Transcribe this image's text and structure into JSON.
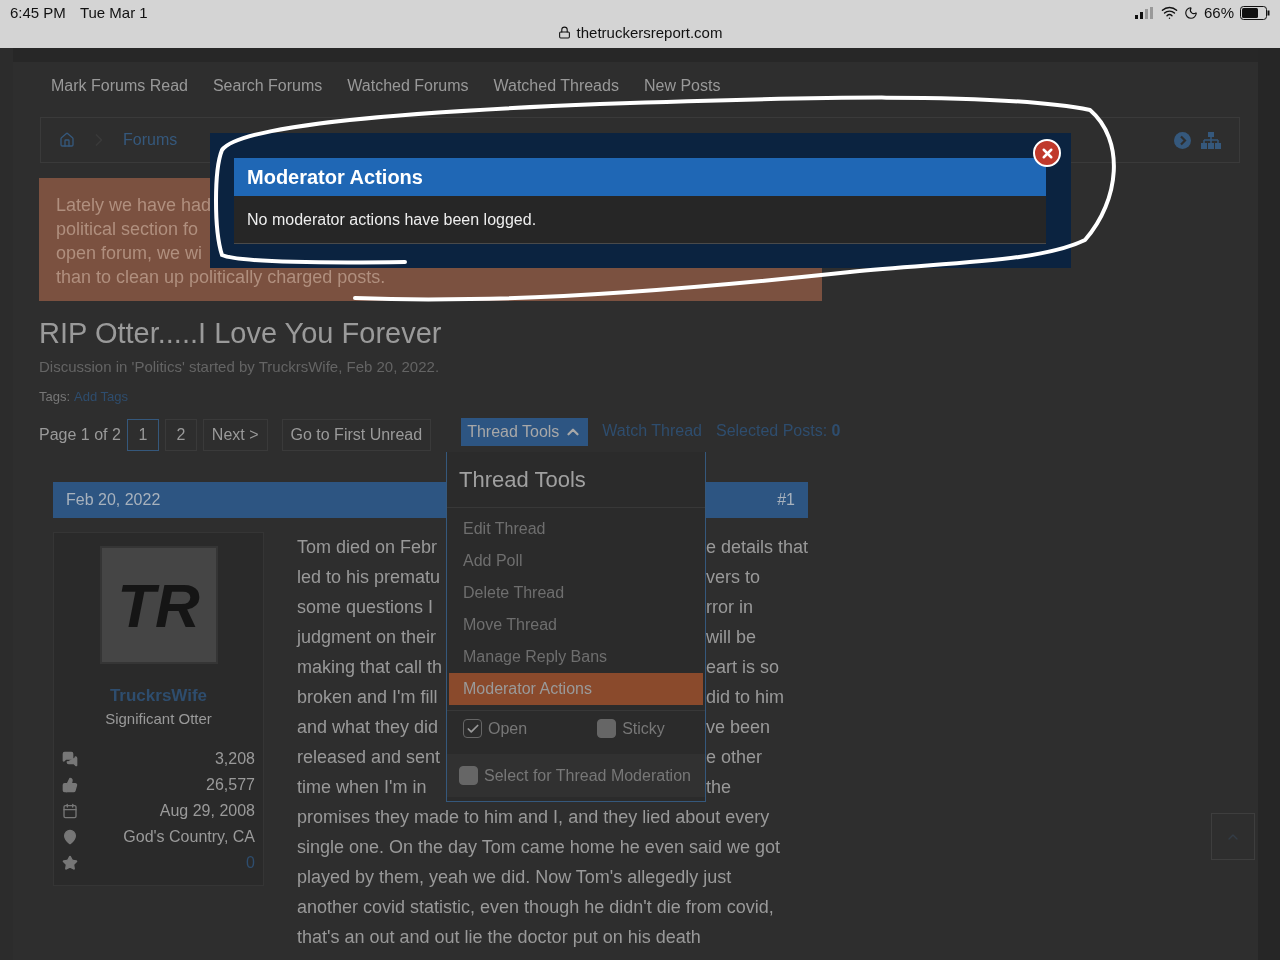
{
  "status_bar": {
    "time": "6:45 PM",
    "date": "Tue Mar 1",
    "url": "thetruckersreport.com",
    "battery": "66%"
  },
  "nav_tabs": [
    "Mark Forums Read",
    "Search Forums",
    "Watched Forums",
    "Watched Threads",
    "New Posts"
  ],
  "breadcrumb": {
    "items": [
      "Forums"
    ]
  },
  "notice": {
    "lines": [
      "Lately we have had",
      "political section fo",
      "open forum, we wi",
      "than to clean up politically charged posts."
    ]
  },
  "thread": {
    "title": "RIP Otter.....I Love You Forever",
    "meta": "Discussion in 'Politics' started by TruckrsWife, Feb 20, 2022.",
    "tags_label": "Tags:",
    "tags_link": "Add Tags"
  },
  "pagination": {
    "label": "Page 1 of 2",
    "pages": [
      {
        "label": "1",
        "selected": true
      },
      {
        "label": "2",
        "selected": false
      }
    ],
    "next": "Next >",
    "first_unread": "Go to First Unread"
  },
  "thread_actions": {
    "tools": "Thread Tools",
    "expanded": true,
    "watch": "Watch Thread",
    "selected_posts_label": "Selected Posts:",
    "selected_posts_count": "0"
  },
  "dropdown": {
    "title": "Thread Tools",
    "items": [
      {
        "label": "Edit Thread",
        "selected": false
      },
      {
        "label": "Add Poll",
        "selected": false
      },
      {
        "label": "Delete Thread",
        "selected": false
      },
      {
        "label": "Move Thread",
        "selected": false
      },
      {
        "label": "Manage Reply Bans",
        "selected": false
      },
      {
        "label": "Moderator Actions",
        "selected": true
      }
    ],
    "checkboxes": [
      {
        "label": "Open",
        "checked": true
      },
      {
        "label": "Sticky",
        "checked": false
      }
    ],
    "moderation": {
      "label": "Select for Thread Moderation",
      "checked": false
    }
  },
  "post": {
    "date": "Feb 20, 2022",
    "number": "#1",
    "avatar_initials": "TR",
    "author": "TruckrsWife",
    "user_title": "Significant Otter",
    "stats": [
      {
        "kind": "messages",
        "value": "3,208"
      },
      {
        "kind": "likes",
        "value": "26,577"
      },
      {
        "kind": "joined",
        "value": "Aug 29, 2008"
      },
      {
        "kind": "location",
        "value": "God's Country, CA"
      },
      {
        "kind": "trophies",
        "value": "0"
      }
    ],
    "lines": [
      {
        "left": "Tom died on Febr",
        "right": "e details that"
      },
      {
        "left": "led to his prematu",
        "right": "vers to"
      },
      {
        "left": "some questions I",
        "right": "rror in"
      },
      {
        "left": "judgment on their",
        "right": "will be"
      },
      {
        "left": "making that call th",
        "right": "eart is so"
      },
      {
        "left": "broken and I'm fill",
        "right": "did to him"
      },
      {
        "left": "and what they did",
        "right": "ve been"
      },
      {
        "left": "released and sent",
        "right": "e other"
      },
      {
        "left": "time when I'm in",
        "right": "the"
      },
      {
        "text": "promises they made to him and I, and they lied about every"
      },
      {
        "text": "single one. On the day Tom came home he even said we got"
      },
      {
        "text": "played by them, yeah we did. Now Tom's allegedly just"
      },
      {
        "text": "another covid statistic, even though he didn't die from covid,"
      },
      {
        "text": "that's an out and out lie the doctor put on his death"
      }
    ]
  },
  "modal": {
    "title": "Moderator Actions",
    "message": "No moderator actions have been logged."
  }
}
